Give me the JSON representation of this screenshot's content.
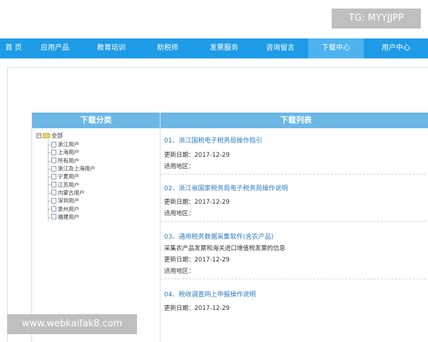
{
  "watermarks": {
    "tg": "TG: MYYJJPP",
    "url": "www.webkaifak8.com"
  },
  "nav": {
    "items": [
      {
        "label": "首 页"
      },
      {
        "label": "应用产品"
      },
      {
        "label": "教育培训"
      },
      {
        "label": "助税师"
      },
      {
        "label": "发票服务"
      },
      {
        "label": "咨询留言"
      },
      {
        "label": "下载中心"
      },
      {
        "label": "用户中心"
      }
    ],
    "active_index": 6
  },
  "category_panel": {
    "header": "下载分类",
    "root_label": "全部",
    "items": [
      {
        "label": "浙江用户"
      },
      {
        "label": "上海用户"
      },
      {
        "label": "所有用户"
      },
      {
        "label": "浙江及上海用户"
      },
      {
        "label": "宁夏用户"
      },
      {
        "label": "江苏用户"
      },
      {
        "label": "内蒙古用户"
      },
      {
        "label": "深圳用户"
      },
      {
        "label": "泉州用户"
      },
      {
        "label": "福建用户"
      }
    ]
  },
  "download_panel": {
    "header": "下载列表",
    "entries": [
      {
        "title": "01、浙江国税电子税务局操作指引",
        "lines": [
          "更新日期：2017-12-29",
          "适用地区："
        ]
      },
      {
        "title": "02、浙江省国家税务局电子税务局操作说明",
        "lines": [
          "更新日期：2017-12-29",
          "适用地区："
        ]
      },
      {
        "title": "03、通用税务数据采集软件(含农产品)",
        "lines": [
          "采集农产品发票和海关进口增值税发票的信息",
          "更新日期：2017-12-29",
          "适用地区："
        ]
      },
      {
        "title": "04、税收调查网上申报操作说明",
        "lines": [
          "更新日期：2017-12-29"
        ]
      }
    ]
  },
  "colors": {
    "nav_bg": "#1e9be6",
    "nav_active": "#4db3ef",
    "panel_header": "#6cb7e6",
    "link": "#2b7bbf"
  }
}
